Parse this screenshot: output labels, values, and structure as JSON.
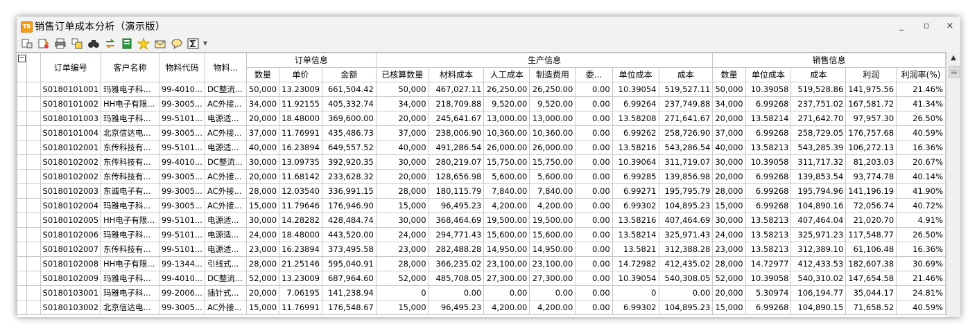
{
  "window": {
    "title": "销售订单成本分析（演示版）",
    "app_icon_label": "TB",
    "minimize_label": "_",
    "restore_label": "▫",
    "close_label": "×"
  },
  "toolbar": {
    "icons": [
      "print-preview-icon",
      "refresh-icon",
      "print-icon",
      "filter-icon",
      "find-icon",
      "convert-icon",
      "export-icon",
      "favorite-icon",
      "mail-icon",
      "comment-icon",
      "sum-icon",
      "dropdown-icon"
    ]
  },
  "grid": {
    "collapse_symbol": "−",
    "groups": {
      "order": "订单信息",
      "production": "生产信息",
      "sales": "销售信息"
    },
    "base_headers": {
      "order_no": "订单编号",
      "customer": "客户名称",
      "material_code": "物料代码",
      "material": "物料..."
    },
    "order_headers": [
      "数量",
      "单价",
      "金额"
    ],
    "production_headers": [
      "已核算数量",
      "材料成本",
      "人工成本",
      "制造费用",
      "委...",
      "单位成本",
      "成本"
    ],
    "sales_headers": [
      "数量",
      "单位成本",
      "成本",
      "利润",
      "利润率(%)"
    ],
    "rows": [
      [
        "S0180101001",
        "玛雅电子科...",
        "99-4010...",
        "DC整流...",
        "50,000",
        "13.23009",
        "661,504.42",
        "50,000",
        "467,027.11",
        "26,250.00",
        "26,250.00",
        "0.00",
        "10.39054",
        "519,527.11",
        "50,000",
        "10.39058",
        "519,528.86",
        "141,975.56",
        "21.46%"
      ],
      [
        "S0180101002",
        "HH电子有限...",
        "99-3005...",
        "AC外接...",
        "34,000",
        "11.92155",
        "405,332.74",
        "34,000",
        "218,709.88",
        "9,520.00",
        "9,520.00",
        "0.00",
        "6.99264",
        "237,749.88",
        "34,000",
        "6.99268",
        "237,751.02",
        "167,581.72",
        "41.34%"
      ],
      [
        "S0180101003",
        "玛雅电子科...",
        "99-5101...",
        "电源适...",
        "20,000",
        "18.48000",
        "369,600.00",
        "20,000",
        "245,641.67",
        "13,000.00",
        "13,000.00",
        "0.00",
        "13.58208",
        "271,641.67",
        "20,000",
        "13.58214",
        "271,642.70",
        "97,957.30",
        "26.50%"
      ],
      [
        "S0180101004",
        "北京信达电...",
        "99-3005...",
        "AC外接...",
        "37,000",
        "11.76991",
        "435,486.73",
        "37,000",
        "238,006.90",
        "10,360.00",
        "10,360.00",
        "0.00",
        "6.99262",
        "258,726.90",
        "37,000",
        "6.99268",
        "258,729.05",
        "176,757.68",
        "40.59%"
      ],
      [
        "S0180102001",
        "东传科技有...",
        "99-5101...",
        "电源适...",
        "40,000",
        "16.23894",
        "649,557.52",
        "40,000",
        "491,286.54",
        "26,000.00",
        "26,000.00",
        "0.00",
        "13.58216",
        "543,286.54",
        "40,000",
        "13.58213",
        "543,285.39",
        "106,272.13",
        "16.36%"
      ],
      [
        "S0180102002",
        "东传科技有...",
        "99-4010...",
        "DC整流...",
        "30,000",
        "13.09735",
        "392,920.35",
        "30,000",
        "280,219.07",
        "15,750.00",
        "15,750.00",
        "0.00",
        "10.39064",
        "311,719.07",
        "30,000",
        "10.39058",
        "311,717.32",
        "81,203.03",
        "20.67%"
      ],
      [
        "S0180102002",
        "东传科技有...",
        "99-3005...",
        "AC外接...",
        "20,000",
        "11.68142",
        "233,628.32",
        "20,000",
        "128,656.98",
        "5,600.00",
        "5,600.00",
        "0.00",
        "6.99285",
        "139,856.98",
        "20,000",
        "6.99268",
        "139,853.54",
        "93,774.78",
        "40.14%"
      ],
      [
        "S0180102003",
        "东诚电子有...",
        "99-3005...",
        "AC外接...",
        "28,000",
        "12.03540",
        "336,991.15",
        "28,000",
        "180,115.79",
        "7,840.00",
        "7,840.00",
        "0.00",
        "6.99271",
        "195,795.79",
        "28,000",
        "6.99268",
        "195,794.96",
        "141,196.19",
        "41.90%"
      ],
      [
        "S0180102004",
        "玛雅电子科...",
        "99-3005...",
        "AC外接...",
        "15,000",
        "11.79646",
        "176,946.90",
        "15,000",
        "96,495.23",
        "4,200.00",
        "4,200.00",
        "0.00",
        "6.99302",
        "104,895.23",
        "15,000",
        "6.99268",
        "104,890.16",
        "72,056.74",
        "40.72%"
      ],
      [
        "S0180102005",
        "HH电子有限...",
        "99-5101...",
        "电源适...",
        "30,000",
        "14.28282",
        "428,484.74",
        "30,000",
        "368,464.69",
        "19,500.00",
        "19,500.00",
        "0.00",
        "13.58216",
        "407,464.69",
        "30,000",
        "13.58213",
        "407,464.04",
        "21,020.70",
        "4.91%"
      ],
      [
        "S0180102006",
        "玛雅电子科...",
        "99-5101...",
        "电源适...",
        "24,000",
        "18.48000",
        "443,520.00",
        "24,000",
        "294,771.43",
        "15,600.00",
        "15,600.00",
        "0.00",
        "13.58214",
        "325,971.43",
        "24,000",
        "13.58213",
        "325,971.23",
        "117,548.77",
        "26.50%"
      ],
      [
        "S0180102007",
        "东传科技有...",
        "99-5101...",
        "电源适...",
        "23,000",
        "16.23894",
        "373,495.58",
        "23,000",
        "282,488.28",
        "14,950.00",
        "14,950.00",
        "0.00",
        "13.5821",
        "312,388.28",
        "23,000",
        "13.58213",
        "312,389.10",
        "61,106.48",
        "16.36%"
      ],
      [
        "S0180102008",
        "HH电子有限...",
        "99-1344...",
        "引线式...",
        "28,000",
        "21.25146",
        "595,040.91",
        "28,000",
        "366,235.02",
        "23,100.00",
        "23,100.00",
        "0.00",
        "14.72982",
        "412,435.02",
        "28,000",
        "14.72977",
        "412,433.53",
        "182,607.38",
        "30.69%"
      ],
      [
        "S0180102009",
        "玛雅电子科...",
        "99-4010...",
        "DC整流...",
        "52,000",
        "13.23009",
        "687,964.60",
        "52,000",
        "485,708.05",
        "27,300.00",
        "27,300.00",
        "0.00",
        "10.39054",
        "540,308.05",
        "52,000",
        "10.39058",
        "540,310.02",
        "147,654.58",
        "21.46%"
      ],
      [
        "S0180103001",
        "玛雅电子科...",
        "99-2006...",
        "插针式...",
        "20,000",
        "7.06195",
        "141,238.94",
        "0",
        "0.00",
        "0.00",
        "0.00",
        "0.00",
        "0",
        "0.00",
        "20,000",
        "5.30974",
        "106,194.77",
        "35,044.17",
        "24.81%"
      ],
      [
        "S0180103002",
        "北京信达电...",
        "99-3005...",
        "AC外接...",
        "15,000",
        "11.76991",
        "176,548.67",
        "15,000",
        "96,495.23",
        "4,200.00",
        "4,200.00",
        "0.00",
        "6.99302",
        "104,895.23",
        "15,000",
        "6.99268",
        "104,890.15",
        "71,658.52",
        "40.59%"
      ]
    ]
  },
  "scrollbar": {
    "up_arrow": "▲"
  }
}
